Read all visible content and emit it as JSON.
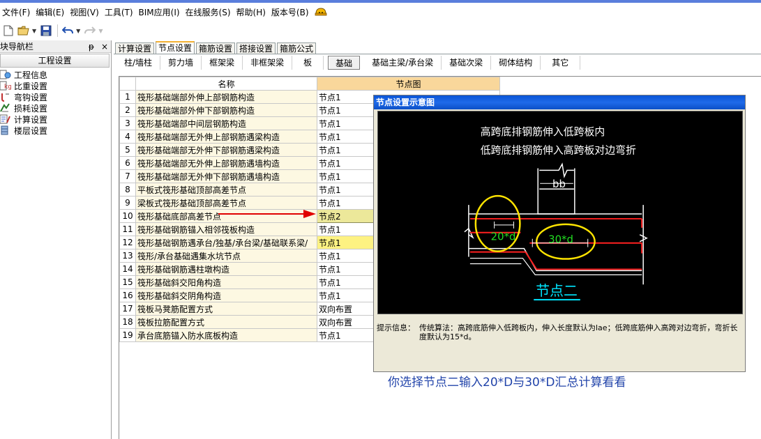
{
  "menu": [
    "文件(F)",
    "编辑(E)",
    "视图(V)",
    "工具(T)",
    "BIM应用(I)",
    "在线服务(S)",
    "帮助(H)",
    "版本号(B)"
  ],
  "left_panel": {
    "title": "块导航栏",
    "pin": "ᵽ",
    "close": "×",
    "header": "工程设置",
    "items": [
      "工程信息",
      "比重设置",
      "弯钩设置",
      "损耗设置",
      "计算设置",
      "楼层设置"
    ]
  },
  "tabs": [
    "计算设置",
    "节点设置",
    "箍筋设置",
    "搭接设置",
    "箍筋公式"
  ],
  "active_tab": 1,
  "subtabs": [
    "柱/墙柱",
    "剪力墙",
    "框架梁",
    "非框架梁",
    "板",
    "基础",
    "基础主梁/承台梁",
    "基础次梁",
    "砌体结构",
    "其它"
  ],
  "active_subtab": 5,
  "grid": {
    "headers": [
      "",
      "名称",
      "节点图"
    ],
    "rows": [
      {
        "no": "1",
        "name": "筏形基础端部外伸上部钢筋构造",
        "node": "节点1"
      },
      {
        "no": "2",
        "name": "筏形基础端部外伸下部钢筋构造",
        "node": "节点1"
      },
      {
        "no": "3",
        "name": "筏形基础端部中间层钢筋构造",
        "node": "节点1"
      },
      {
        "no": "4",
        "name": "筏形基础端部无外伸上部钢筋遇梁构造",
        "node": "节点1"
      },
      {
        "no": "5",
        "name": "筏形基础端部无外伸下部钢筋遇梁构造",
        "node": "节点1"
      },
      {
        "no": "6",
        "name": "筏形基础端部无外伸上部钢筋遇墙构造",
        "node": "节点1"
      },
      {
        "no": "7",
        "name": "筏形基础端部无外伸下部钢筋遇墙构造",
        "node": "节点1"
      },
      {
        "no": "8",
        "name": "平板式筏形基础顶部高差节点",
        "node": "节点1"
      },
      {
        "no": "9",
        "name": "梁板式筏形基础顶部高差节点",
        "node": "节点1"
      },
      {
        "no": "10",
        "name": "筏形基础底部高差节点",
        "node": "节点2"
      },
      {
        "no": "11",
        "name": "筏形基础钢筋锚入相邻筏板构造",
        "node": "节点1"
      },
      {
        "no": "12",
        "name": "筏形基础钢筋遇承台/独基/承台梁/基础联系梁/",
        "node": "节点1"
      },
      {
        "no": "13",
        "name": "筏形/承台基础遇集水坑节点",
        "node": "节点1"
      },
      {
        "no": "14",
        "name": "筏形基础钢筋遇柱墩构造",
        "node": "节点1"
      },
      {
        "no": "15",
        "name": "筏形基础斜交阳角构造",
        "node": "节点1"
      },
      {
        "no": "16",
        "name": "筏形基础斜交阴角构造",
        "node": "节点1"
      },
      {
        "no": "17",
        "name": "筏板马凳筋配置方式",
        "node": "双向布置"
      },
      {
        "no": "18",
        "name": "筏板拉筋配置方式",
        "node": "双向布置"
      },
      {
        "no": "19",
        "name": "承台底筋锚入防水底板构造",
        "node": "节点1"
      }
    ]
  },
  "dialog": {
    "title": "节点设置示意图",
    "canvas_line1": "高跨底排钢筋伸入低跨板内",
    "canvas_line2": "低跨底排钢筋伸入高跨板对边弯折",
    "dim_bb": "bb",
    "dim_20d": "20*d",
    "dim_30d": "30*d",
    "node_label": "节点二",
    "hint_label": "提示信息：",
    "hint_text": "传统算法：高跨底筋伸入低跨板内，伸入长度默认为lae；低跨底筋伸入高跨对边弯折，弯折长度默认为15*d。"
  },
  "bottom_note": "你选择节点二输入20*D与30*D汇总计算看看",
  "colors": {
    "title_bar": "#1f6ae9",
    "header_node": "#f9d79b",
    "name_col": "#fdf8e2",
    "highlight_row": "#fdf282",
    "rebar_red": "#ff2020",
    "ellipse_yellow": "#ffe400",
    "dim_green": "#22dd22",
    "node_cyan": "#00e5ff",
    "note_blue": "#2244aa"
  }
}
